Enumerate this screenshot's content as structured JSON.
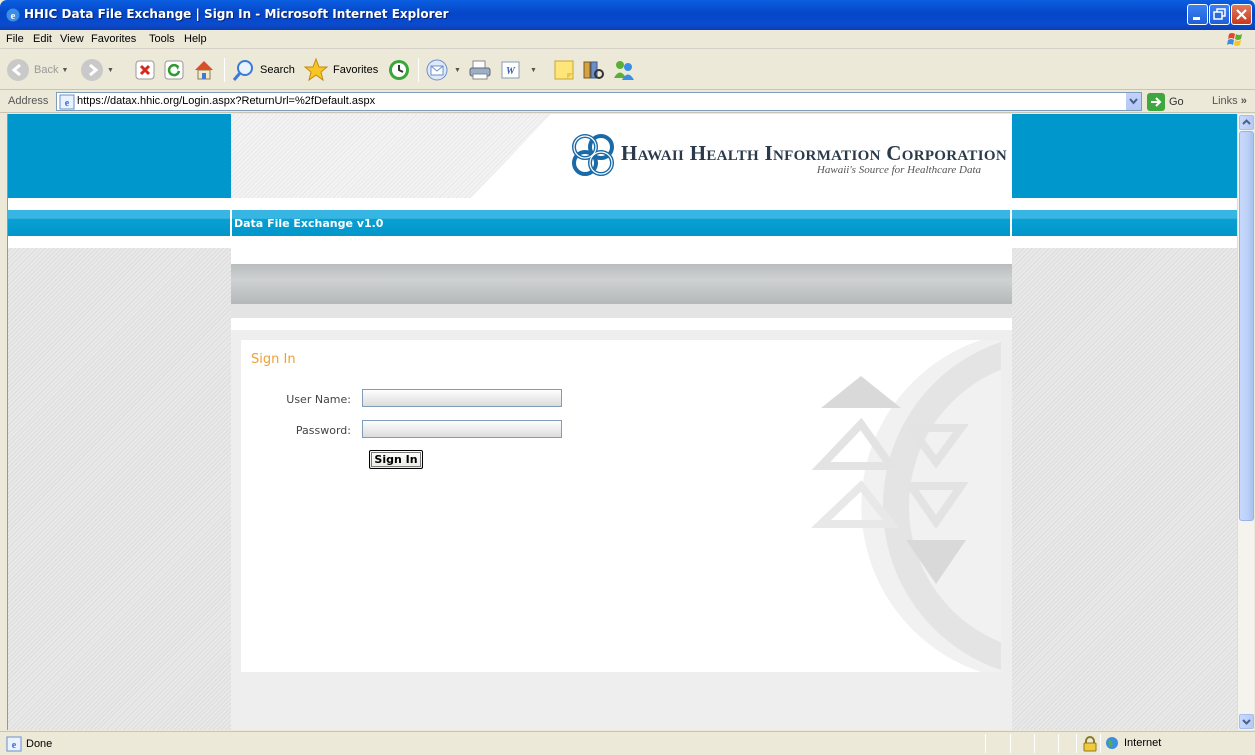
{
  "window": {
    "title": "HHIC Data File Exchange | Sign In - Microsoft Internet Explorer"
  },
  "menu": [
    "File",
    "Edit",
    "View",
    "Favorites",
    "Tools",
    "Help"
  ],
  "toolbar": {
    "back": "Back",
    "search": "Search",
    "favorites": "Favorites"
  },
  "address": {
    "label": "Address",
    "url": "https://datax.hhic.org/Login.aspx?ReturnUrl=%2fDefault.aspx",
    "go": "Go",
    "links": "Links"
  },
  "site": {
    "org_name": "Hawaii Health Information Corporation",
    "tagline": "Hawaii's Source for Healthcare Data",
    "app_title": "Data File Exchange v1.0"
  },
  "signin": {
    "heading": "Sign In",
    "username_label": "User Name:",
    "password_label": "Password:",
    "button": "Sign In"
  },
  "status": {
    "text": "Done",
    "zone": "Internet"
  },
  "colors": {
    "brand_blue": "#0098cc",
    "heading_orange": "#f0a030",
    "xp_title_blue": "#0a5fe0"
  },
  "icons": [
    "ie-icon",
    "minimize-icon",
    "maximize-icon",
    "close-icon",
    "windows-flag-icon",
    "back-icon",
    "forward-icon",
    "stop-icon",
    "refresh-icon",
    "home-icon",
    "search-icon",
    "favorites-star-icon",
    "history-icon",
    "mail-icon",
    "print-icon",
    "word-icon",
    "notes-icon",
    "research-icon",
    "messenger-icon",
    "page-icon",
    "go-arrow-icon",
    "lock-icon",
    "globe-icon",
    "hhic-logo-icon"
  ]
}
